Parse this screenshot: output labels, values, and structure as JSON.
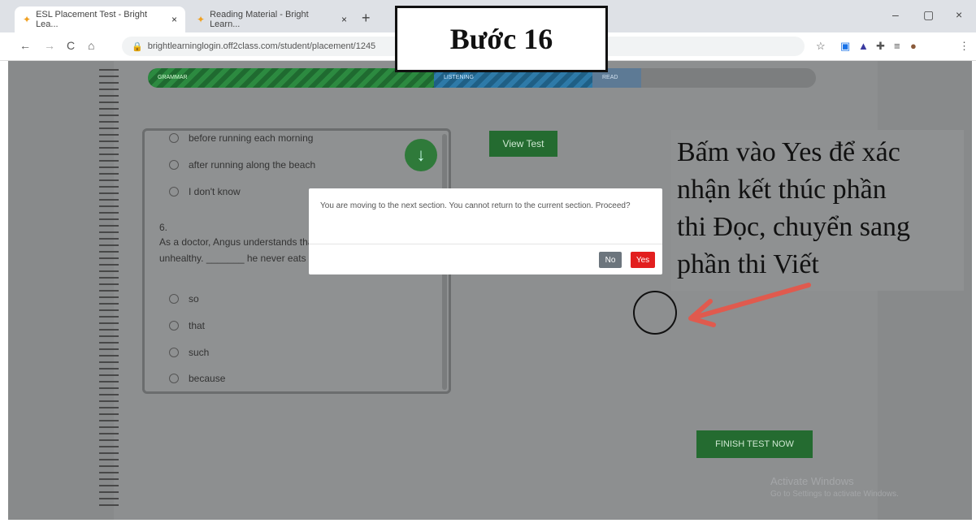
{
  "browser": {
    "tabs": [
      {
        "title": "ESL Placement Test - Bright Lea...",
        "close": "×",
        "active": true
      },
      {
        "title": "Reading Material - Bright Learn...",
        "close": "×",
        "active": false
      }
    ],
    "new_tab": "+",
    "window_controls": {
      "minimize": "–",
      "maximize": "▢",
      "close": "×"
    },
    "url": "brightlearninglogin.off2class.com/student/placement/1245",
    "nav": {
      "back": "←",
      "forward": "→",
      "reload": "C",
      "home": "⌂"
    }
  },
  "overlay": {
    "step_label": "Bước 16",
    "annotation_lines": [
      "Bấm vào Yes để xác",
      "nhận kết thúc phần",
      "thi Đọc, chuyển sang",
      "phần thi Viết"
    ]
  },
  "progress": {
    "segments": [
      {
        "label": "GRAMMAR"
      },
      {
        "label": "LISTENING"
      },
      {
        "label": "READ"
      }
    ]
  },
  "question_card": {
    "prev_options": [
      "before running each morning",
      "after running along the beach",
      "I don't know"
    ],
    "question_number": "6.",
    "question_line1": "As a doctor, Angus understands that sugar is",
    "question_line2": "unhealthy. _______ he never eats",
    "options": [
      "so",
      "that",
      "such",
      "because"
    ]
  },
  "buttons": {
    "view_test": "View Test",
    "finish_test": "FINISH TEST NOW",
    "download_icon": "↓"
  },
  "dialog": {
    "message": "You are moving to the next section. You cannot return to the current section. Proceed?",
    "no": "No",
    "yes": "Yes"
  },
  "watermark": {
    "line1": "Activate Windows",
    "line2": "Go to Settings to activate Windows."
  },
  "colors": {
    "green": "#246b30",
    "yes_red": "#e21f1f",
    "arrow_red": "#e05a4e"
  }
}
